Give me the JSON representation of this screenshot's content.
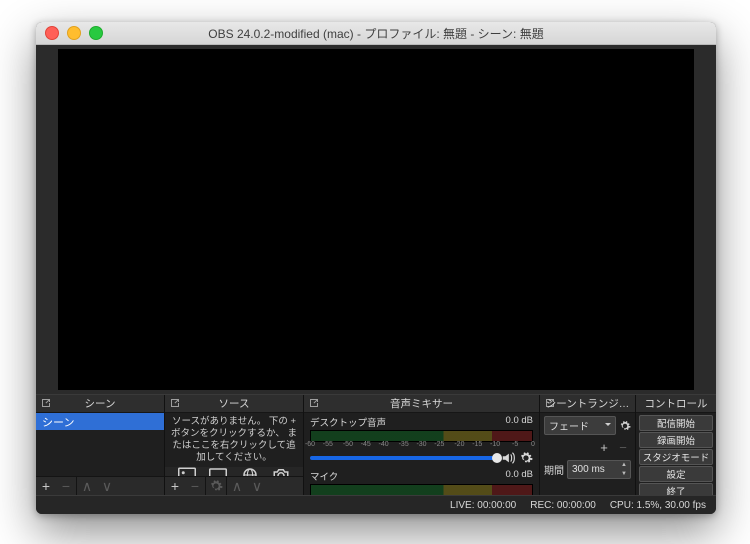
{
  "window": {
    "title": "OBS 24.0.2-modified (mac) - プロファイル: 無題 - シーン: 無題"
  },
  "scenes": {
    "title": "シーン",
    "items": [
      "シーン"
    ]
  },
  "sources": {
    "title": "ソース",
    "empty_hint": "ソースがありません。\n下の + ボタンをクリックするか、\nまたはここを右クリックして追加してください。"
  },
  "mixer": {
    "title": "音声ミキサー",
    "scale_ticks": [
      -60,
      -55,
      -50,
      -45,
      -40,
      -35,
      -30,
      -25,
      -20,
      -15,
      -10,
      -5,
      0
    ],
    "channels": [
      {
        "name": "デスクトップ音声",
        "level": "0.0 dB"
      },
      {
        "name": "マイク",
        "level": "0.0 dB"
      }
    ]
  },
  "transitions": {
    "title": "シーントランジ…",
    "current": "フェード",
    "duration_label": "期間",
    "duration_value": "300 ms"
  },
  "controls": {
    "title": "コントロール",
    "buttons": [
      "配信開始",
      "録画開始",
      "スタジオモード",
      "設定",
      "終了"
    ]
  },
  "status": {
    "live": "LIVE: 00:00:00",
    "rec": "REC: 00:00:00",
    "cpu": "CPU: 1.5%, 30.00 fps"
  }
}
